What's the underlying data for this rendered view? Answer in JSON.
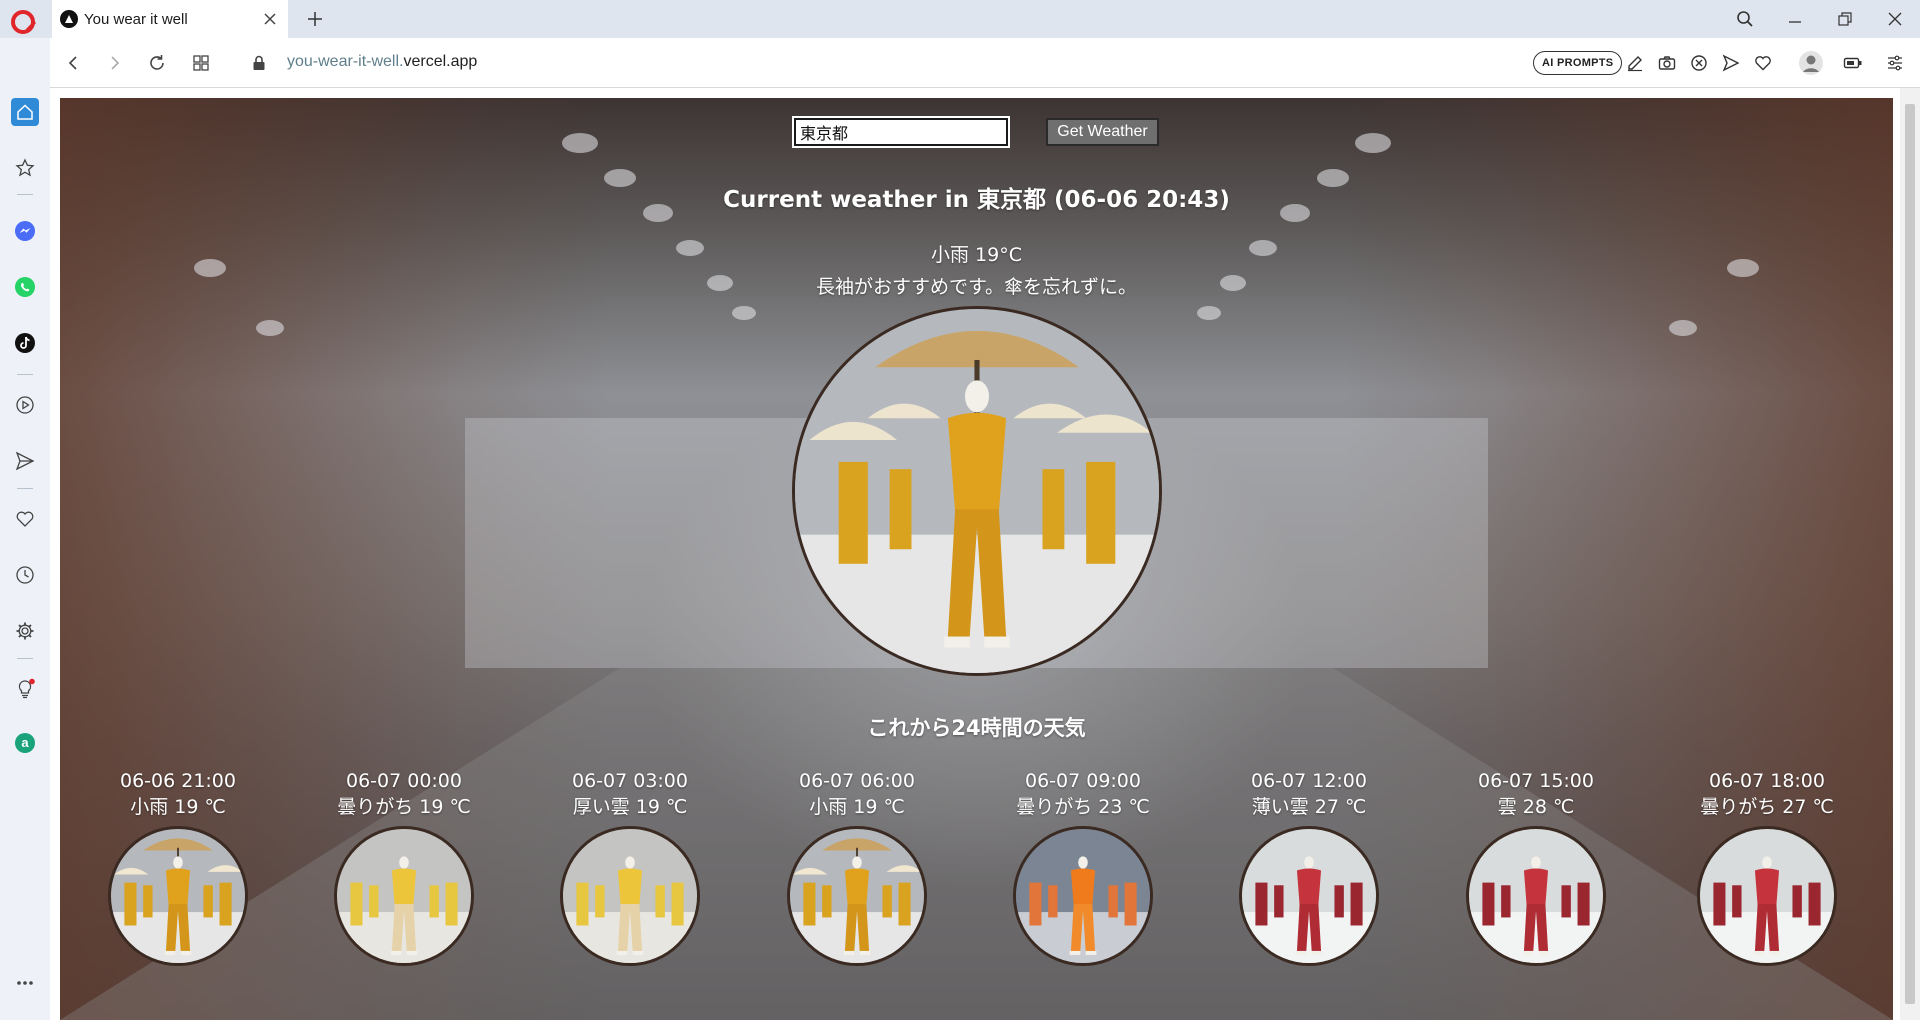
{
  "browser": {
    "tab_title": "You wear it well",
    "url_subdomain": "you-wear-it-well.",
    "url_domain": "vercel.app",
    "ai_prompts_label": "AI PROMPTS"
  },
  "search": {
    "city_value": "東京都",
    "button_label": "Get Weather"
  },
  "current": {
    "heading": "Current weather in 東京都 (06-06 20:43)",
    "condition": "小雨 19°C",
    "advice": "長袖がおすすめです。傘を忘れずに。",
    "outfit_theme": "umbrella-mustard"
  },
  "forecast": {
    "heading": "これから24時間の天気",
    "items": [
      {
        "time": "06-06 21:00",
        "condition": "小雨 19 ℃",
        "outfit_theme": "umbrella-mustard"
      },
      {
        "time": "06-07 00:00",
        "condition": "曇りがち 19 ℃",
        "outfit_theme": "yellow-sweater"
      },
      {
        "time": "06-07 03:00",
        "condition": "厚い雲 19 ℃",
        "outfit_theme": "yellow-sweater"
      },
      {
        "time": "06-07 06:00",
        "condition": "小雨 19 ℃",
        "outfit_theme": "umbrella-mustard"
      },
      {
        "time": "06-07 09:00",
        "condition": "曇りがち 23 ℃",
        "outfit_theme": "orange-summer"
      },
      {
        "time": "06-07 12:00",
        "condition": "薄い雲 27 ℃",
        "outfit_theme": "red-suit"
      },
      {
        "time": "06-07 15:00",
        "condition": "雲 28 ℃",
        "outfit_theme": "red-suit"
      },
      {
        "time": "06-07 18:00",
        "condition": "曇りがち 27 ℃",
        "outfit_theme": "red-suit"
      }
    ]
  },
  "colors": {
    "opera_red": "#e0262b",
    "sidebar_bg": "#eef2f8",
    "home_active": "#2f8ad8",
    "messenger": "#4a6cf7",
    "whatsapp": "#25d366",
    "amazon": "#1aa37a"
  }
}
